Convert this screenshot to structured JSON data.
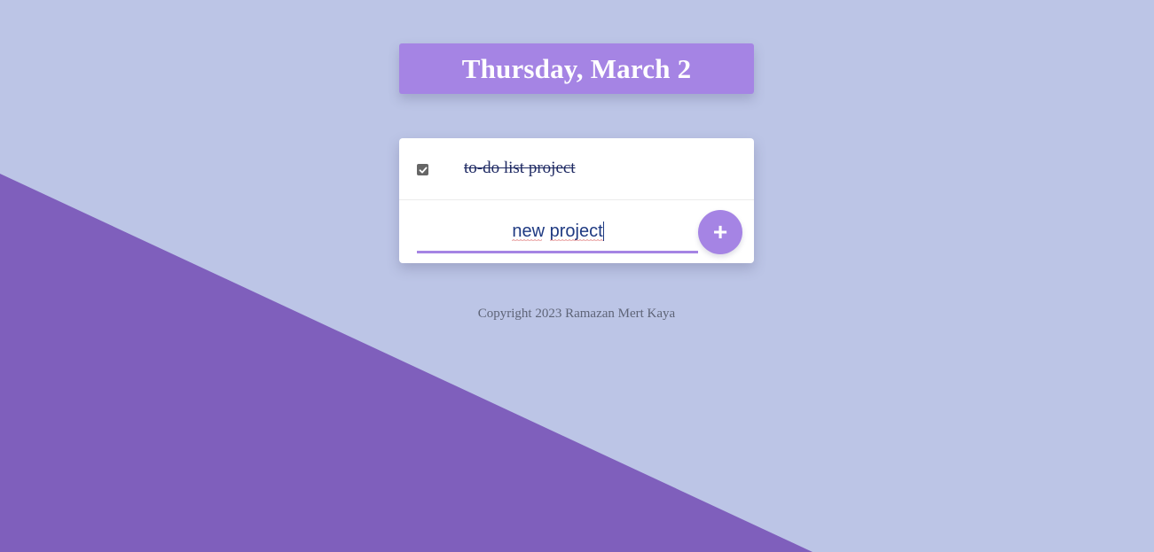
{
  "header": {
    "date_title": "Thursday, March 2"
  },
  "todo": {
    "items": [
      {
        "text": "to-do list project",
        "checked": true
      }
    ],
    "new_item": {
      "value": "new project",
      "placeholder": "",
      "add_label": "+"
    }
  },
  "footer": {
    "copyright": "Copyright 2023 Ramazan Mert Kaya"
  },
  "colors": {
    "background": "#bcc5e6",
    "wedge": "#7f5fbc",
    "accent": "#a584e4",
    "card": "#ffffff",
    "item_text": "#1f2a63",
    "footer_text": "#5e6477"
  }
}
